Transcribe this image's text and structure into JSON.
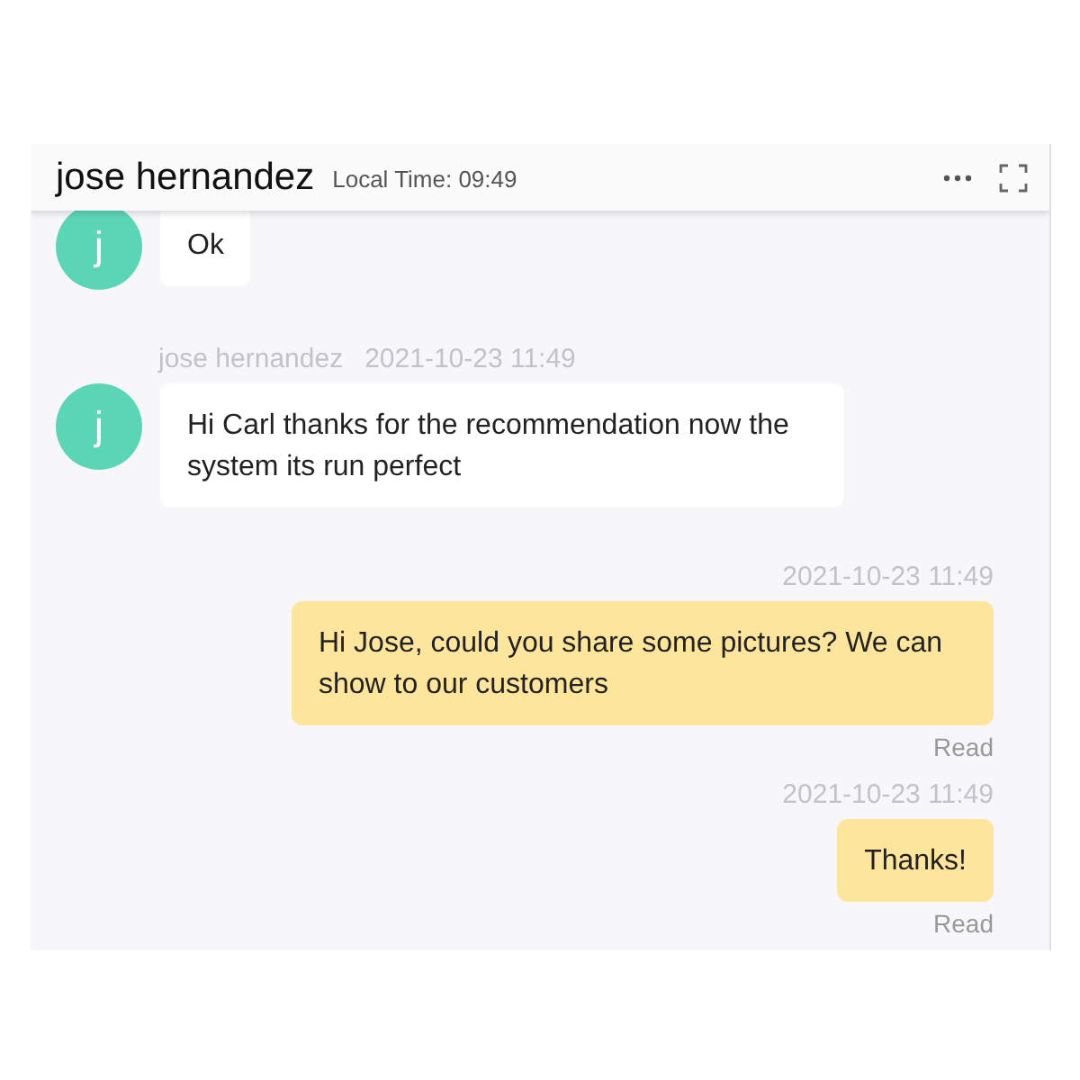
{
  "header": {
    "title": "jose hernandez",
    "local_time": "Local Time: 09:49"
  },
  "messages": [
    {
      "kind": "incoming",
      "avatar": "j",
      "text": "Ok"
    },
    {
      "kind": "incoming",
      "sender": "jose hernandez",
      "time": "2021-10-23 11:49",
      "avatar": "j",
      "text": "Hi Carl thanks for the recommendation now the system its run perfect"
    },
    {
      "kind": "outgoing",
      "time": "2021-10-23 11:49",
      "text": "Hi Jose, could you share some pictures? We can show to our customers",
      "status": "Read"
    },
    {
      "kind": "outgoing",
      "time": "2021-10-23 11:49",
      "text": "Thanks!",
      "status": "Read"
    }
  ]
}
